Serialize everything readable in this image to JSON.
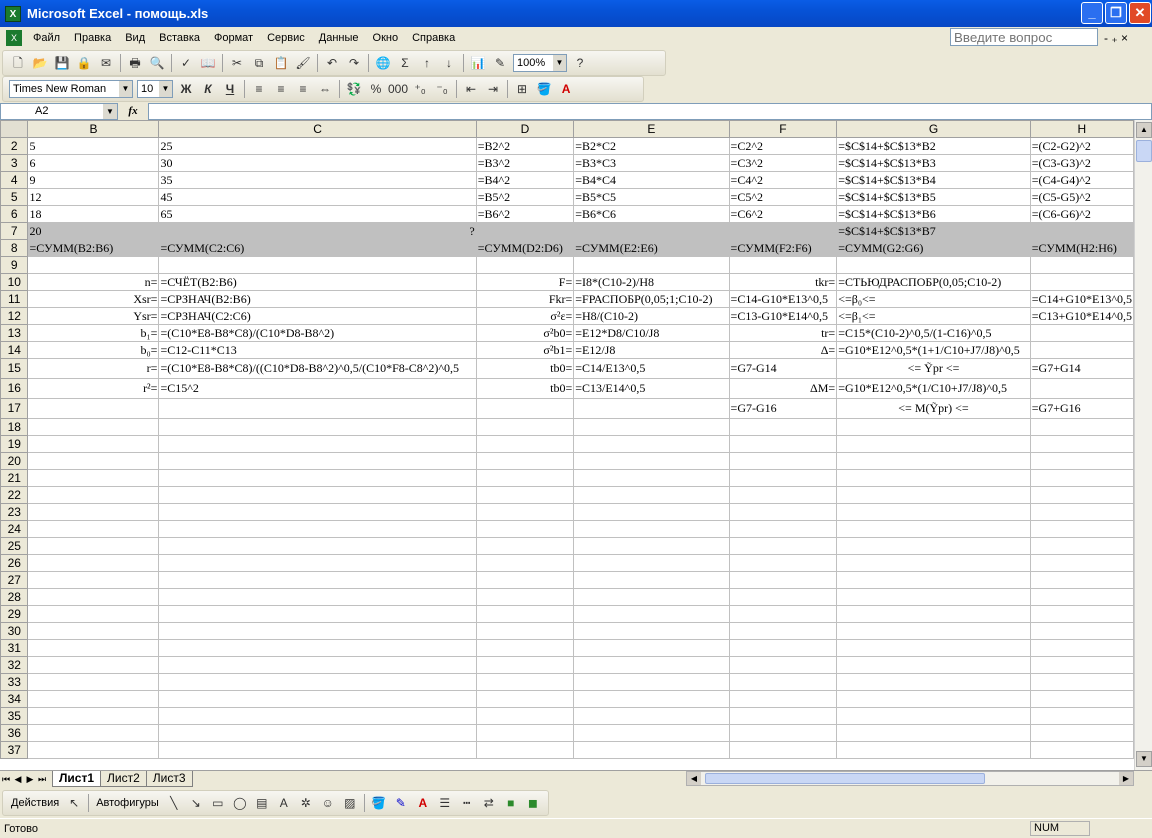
{
  "window": {
    "title": "Microsoft Excel - помощь.xls",
    "min_label": "_",
    "max_label": "❐",
    "close_label": "✕"
  },
  "menu": {
    "items": [
      "Файл",
      "Правка",
      "Вид",
      "Вставка",
      "Формат",
      "Сервис",
      "Данные",
      "Окно",
      "Справка"
    ],
    "help_placeholder": "Введите вопрос",
    "doc_controls": "- ₊ ×"
  },
  "toolbar": {
    "zoom": "100%",
    "font_name": "Times New Roman",
    "font_size": "10",
    "bold": "Ж",
    "italic": "К",
    "underline": "Ч",
    "sum_label": "Σ",
    "percent_label": "%",
    "thousands_label": "000"
  },
  "formula_bar": {
    "name_box": "A2",
    "fx": "fx",
    "content": ""
  },
  "columns": [
    "B",
    "C",
    "D",
    "E",
    "F",
    "G",
    "H"
  ],
  "rows": [
    {
      "n": "2",
      "cells": [
        "5",
        "25",
        "=B2^2",
        "=B2*C2",
        "=C2^2",
        "=$C$14+$C$13*B2",
        "=(C2-G2)^2"
      ]
    },
    {
      "n": "3",
      "cells": [
        "6",
        "30",
        "=B3^2",
        "=B3*C3",
        "=C3^2",
        "=$C$14+$C$13*B3",
        "=(C3-G3)^2"
      ]
    },
    {
      "n": "4",
      "cells": [
        "9",
        "35",
        "=B4^2",
        "=B4*C4",
        "=C4^2",
        "=$C$14+$C$13*B4",
        "=(C4-G4)^2"
      ]
    },
    {
      "n": "5",
      "cells": [
        "12",
        "45",
        "=B5^2",
        "=B5*C5",
        "=C5^2",
        "=$C$14+$C$13*B5",
        "=(C5-G5)^2"
      ]
    },
    {
      "n": "6",
      "cells": [
        "18",
        "65",
        "=B6^2",
        "=B6*C6",
        "=C6^2",
        "=$C$14+$C$13*B6",
        "=(C6-G6)^2"
      ]
    },
    {
      "n": "7",
      "cells": [
        "20",
        "?",
        "",
        "",
        "",
        "=$C$14+$C$13*B7",
        ""
      ]
    },
    {
      "n": "8",
      "cells": [
        "=СУММ(B2:B6)",
        "=СУММ(C2:C6)",
        "=СУММ(D2:D6)",
        "=СУММ(E2:E6)",
        "=СУММ(F2:F6)",
        "=СУММ(G2:G6)",
        "=СУММ(H2:H6)"
      ]
    },
    {
      "n": "9",
      "cells": [
        "",
        "",
        "",
        "",
        "",
        "",
        ""
      ]
    },
    {
      "n": "10",
      "cells": [
        "n=",
        "=СЧЁТ(B2:B6)",
        "F=",
        "=I8*(C10-2)/H8",
        "tkr=",
        "=СТЬЮДРАСПОБР(0,05;C10-2)",
        ""
      ]
    },
    {
      "n": "11",
      "cells": [
        "Xsr=",
        "=СРЗНАЧ(B2:B6)",
        "Fkr=",
        "=FРАСПОБР(0,05;1;C10-2)",
        "=C14-G10*E13^0,5",
        "<=β₀<=",
        "=C14+G10*E13^0,5"
      ]
    },
    {
      "n": "12",
      "cells": [
        "Ysr=",
        "=СРЗНАЧ(C2:C6)",
        "σ²ε=",
        "=H8/(C10-2)",
        "=C13-G10*E14^0,5",
        "<=β₁<=",
        "=C13+G10*E14^0,5"
      ]
    },
    {
      "n": "13",
      "cells": [
        "b₁=",
        "=(C10*E8-B8*C8)/(C10*D8-B8^2)",
        "σ²b0=",
        "=E12*D8/C10/J8",
        "tr=",
        "=C15*(C10-2)^0,5/(1-C16)^0,5",
        ""
      ]
    },
    {
      "n": "14",
      "cells": [
        "b₀=",
        "=C12-C11*C13",
        "σ²b1=",
        "=E12/J8",
        "Δ=",
        "=G10*E12^0,5*(1+1/C10+J7/J8)^0,5",
        ""
      ]
    },
    {
      "n": "15",
      "cells": [
        "r=",
        "=(C10*E8-B8*C8)/((C10*D8-B8^2)^0,5/(C10*F8-C8^2)^0,5",
        "tb0=",
        "=C14/E13^0,5",
        "=G7-G14",
        "<= Ỹpr <=",
        "=G7+G14"
      ]
    },
    {
      "n": "16",
      "cells": [
        "r²=",
        "=C15^2",
        "tb0=",
        "=C13/E14^0,5",
        "ΔM=",
        "=G10*E12^0,5*(1/C10+J7/J8)^0,5",
        ""
      ]
    },
    {
      "n": "17",
      "cells": [
        "",
        "",
        "",
        "",
        "=G7-G16",
        "<= M(Ỹpr) <=",
        "=G7+G16"
      ]
    }
  ],
  "empty_rows": [
    "18",
    "19",
    "20",
    "21",
    "22",
    "23",
    "24",
    "25",
    "26",
    "27",
    "28",
    "29",
    "30",
    "31",
    "32",
    "33",
    "34",
    "35",
    "36",
    "37"
  ],
  "sheet_tabs": [
    "Лист1",
    "Лист2",
    "Лист3"
  ],
  "draw_toolbar": {
    "actions": "Действия",
    "autoshapes": "Автофигуры"
  },
  "status": {
    "left": "Готово",
    "num": "NUM"
  }
}
